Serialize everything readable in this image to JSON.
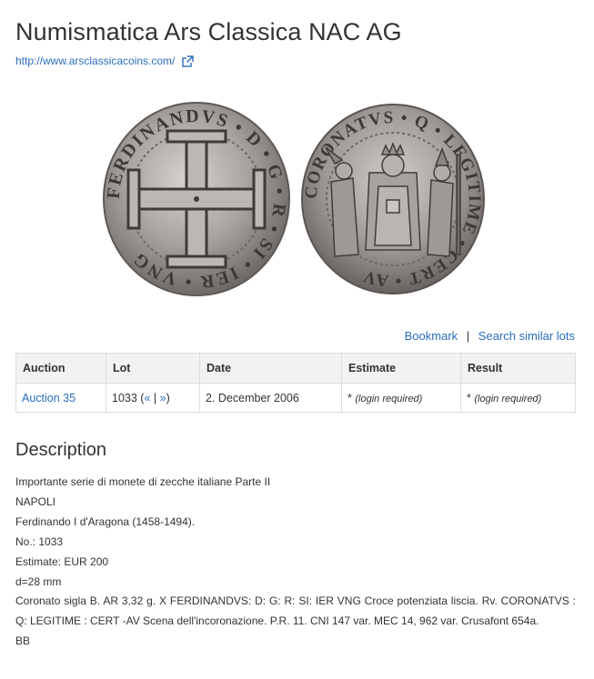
{
  "header": {
    "title": "Numismatica Ars Classica NAC AG",
    "site_url": "http://www.arsclassicacoins.com/"
  },
  "image": {
    "obverse_legend": "FERDINANDVS • D • G • R • SI • IER • VNG",
    "reverse_legend": "CORONATVS • Q • LEGITIME • CERT • AV"
  },
  "actions": {
    "bookmark": "Bookmark",
    "separator": "|",
    "search_similar": "Search similar lots"
  },
  "table": {
    "headers": {
      "auction": "Auction",
      "lot": "Lot",
      "date": "Date",
      "estimate": "Estimate",
      "result": "Result"
    },
    "row": {
      "auction": "Auction 35",
      "lot_number": "1033 (",
      "prev": "«",
      "divider": " | ",
      "next": "»",
      "lot_close": ")",
      "date": "2. December 2006",
      "estimate_star": "*",
      "estimate_note": "(login required)",
      "result_star": "*",
      "result_note": "(login required)"
    }
  },
  "description": {
    "heading": "Description",
    "lines": [
      "Importante serie di monete di zecche italiane Parte II",
      "NAPOLI",
      "Ferdinando I d'Aragona (1458-1494).",
      "No.: 1033",
      "Estimate: EUR 200",
      "d=28 mm"
    ],
    "paragraph": "Coronato sigla B. AR 3,32 g. X FERDINANDVS: D: G: R: SI: IER  VNG Croce potenziata liscia. Rv. CORONATVS : Q: LEGITIME : CERT  -AV Scena dell'incoronazione. P.R. 11. CNI 147 var. MEC 14, 962 var. Crusafont 654a.",
    "grade": "BB"
  },
  "colors": {
    "link": "#2a6ebb",
    "text": "#333333",
    "table_header_bg": "#f2f2f2",
    "border": "#dddddd"
  }
}
